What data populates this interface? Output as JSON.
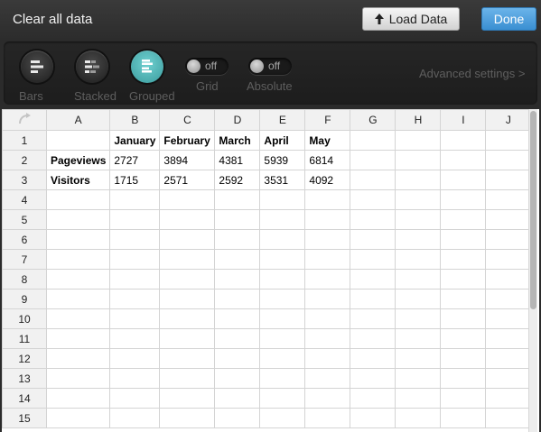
{
  "header": {
    "title": "Clear all data",
    "load_label": "Load Data",
    "done_label": "Done"
  },
  "toolbar": {
    "chart_types": [
      {
        "label": "Bars",
        "icon": "bars-icon",
        "active": false
      },
      {
        "label": "Stacked",
        "icon": "stacked-bars-icon",
        "active": false
      },
      {
        "label": "Grouped",
        "icon": "grouped-bars-icon",
        "active": true
      }
    ],
    "toggles": [
      {
        "label": "Grid",
        "state": "off"
      },
      {
        "label": "Absolute",
        "state": "off"
      }
    ],
    "advanced_label": "Advanced settings >"
  },
  "sheet": {
    "columns": [
      "A",
      "B",
      "C",
      "D",
      "E",
      "F",
      "G",
      "H",
      "I",
      "J"
    ],
    "row_numbers": [
      "1",
      "2",
      "3",
      "4",
      "5",
      "6",
      "7",
      "8",
      "9",
      "10",
      "11",
      "12",
      "13",
      "14",
      "15"
    ],
    "rows": [
      [
        "",
        "January",
        "February",
        "March",
        "April",
        "May",
        "",
        "",
        "",
        ""
      ],
      [
        "Pageviews",
        "2727",
        "3894",
        "4381",
        "5939",
        "6814",
        "",
        "",
        "",
        ""
      ],
      [
        "Visitors",
        "1715",
        "2571",
        "2592",
        "3531",
        "4092",
        "",
        "",
        "",
        ""
      ]
    ]
  },
  "colors": {
    "accent": "#3a9b9d",
    "done_button": "#3a8fd2"
  }
}
